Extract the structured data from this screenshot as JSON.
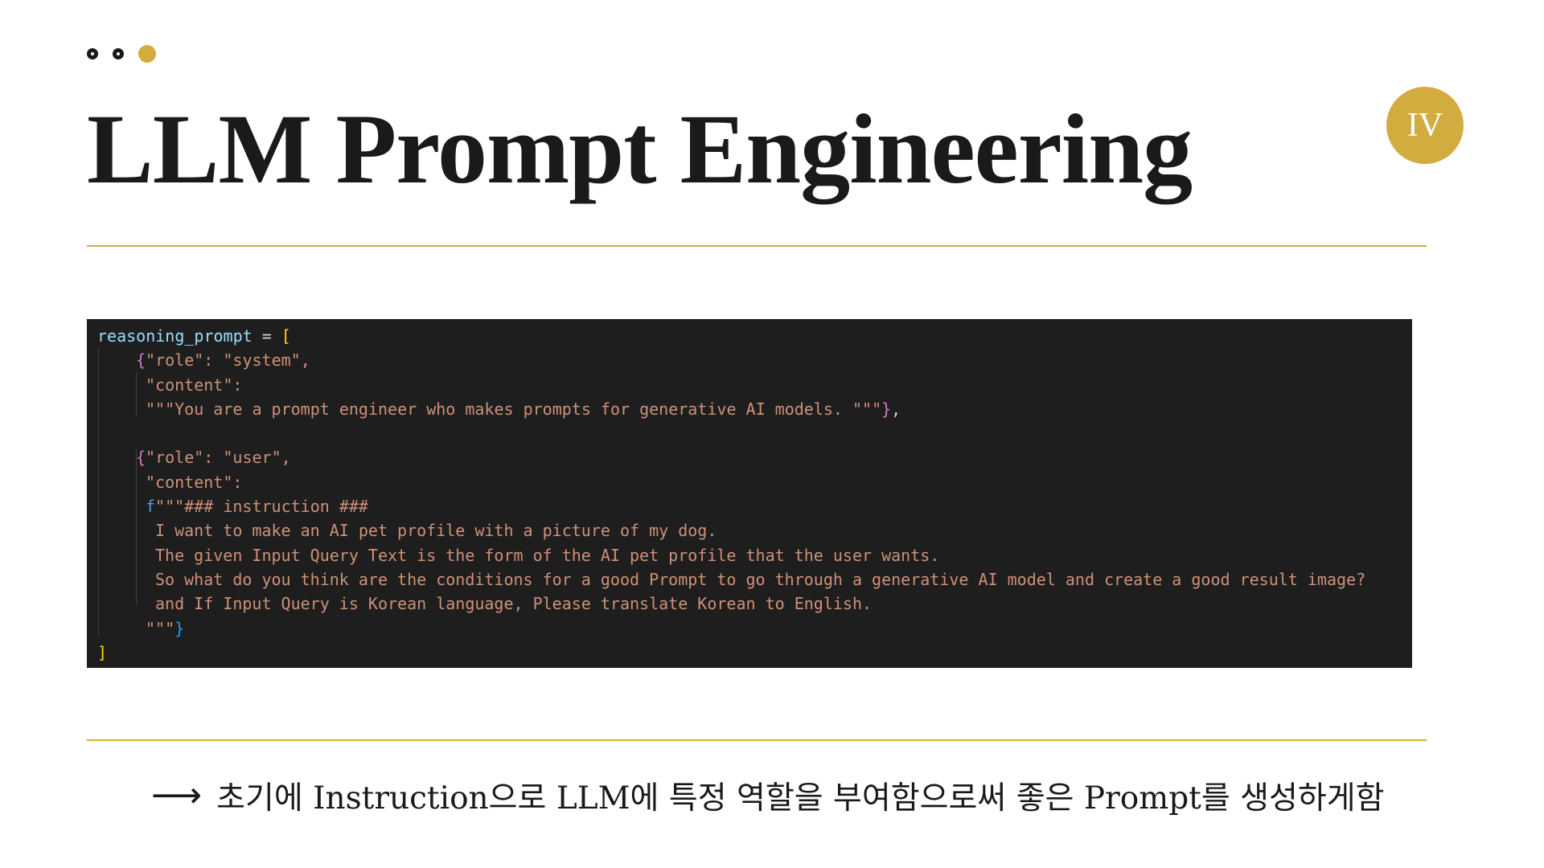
{
  "header": {
    "title": "LLM Prompt Engineering",
    "section_number": "IV"
  },
  "decor": {
    "dot_icons": [
      "ring-dot-icon",
      "ring-dot-icon",
      "filled-dot-icon"
    ],
    "accent_color": "#d3ac3f",
    "text_color": "#1a1a1a",
    "code_background": "#1e1e1e"
  },
  "code": {
    "line1_var": "reasoning_prompt",
    "line1_op": " = ",
    "line1_bracket": "[",
    "line2_open": "{",
    "line2_text": "\"role\": \"system\",",
    "line3_text": "\"content\":",
    "line4_text": "\"\"\"You are a prompt engineer who makes prompts for generative AI models. \"\"\"",
    "line4_close": "}",
    "line4_comma": ",",
    "line6_open": "{",
    "line6_text": "\"role\": \"user\",",
    "line7_text": "\"content\":",
    "line8_prefix": "f",
    "line8_text": "\"\"\"### instruction ###",
    "line9_text": "I want to make an AI pet profile with a picture of my dog.",
    "line10_text": "The given Input Query Text is the form of the AI pet profile that the user wants.",
    "line11_text": "So what do you think are the conditions for a good Prompt to go through a generative AI model and create a good result image?",
    "line12_text": "and If Input Query is Korean language, Please translate Korean to English.",
    "line13_text": "\"\"\"",
    "line13_close": "}",
    "line14_bracket": "]"
  },
  "note": {
    "arrow_icon": "long-right-arrow-icon",
    "arrow": "⟶",
    "text": "초기에 Instruction으로 LLM에 특정 역할을 부여함으로써 좋은 Prompt를 생성하게함"
  }
}
